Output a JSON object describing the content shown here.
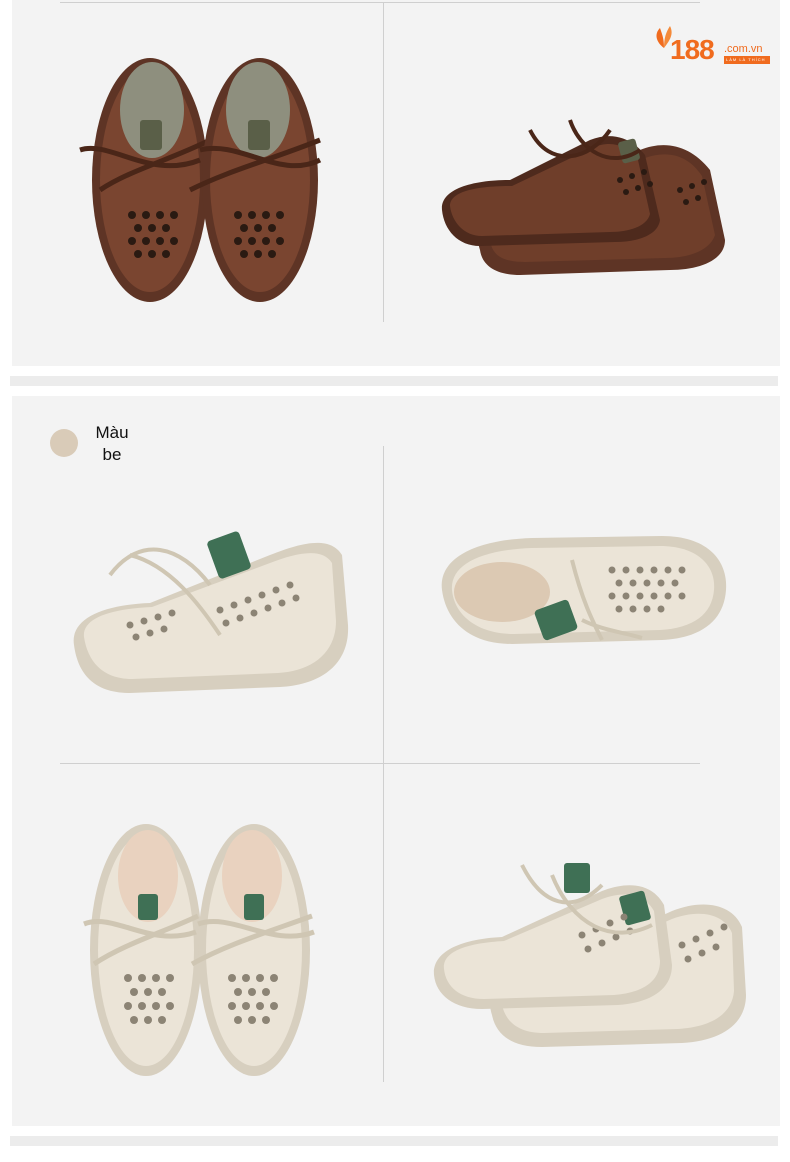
{
  "logo": {
    "number": "188",
    "domain": ".com.vn",
    "tagline": "LÀM LÀ THÍCH",
    "brand_color": "#f06b1e"
  },
  "color_variant": {
    "label": "Màu be",
    "swatch_color": "#d9cbb8"
  },
  "products": [
    {
      "name": "brown-shoes-top-view",
      "color": "#7a4530"
    },
    {
      "name": "brown-shoes-side-view",
      "color": "#6f3e2a"
    },
    {
      "name": "beige-shoe-side-view",
      "color": "#e6ded0"
    },
    {
      "name": "beige-shoe-laid-view",
      "color": "#e6ded0"
    },
    {
      "name": "beige-shoes-top-view",
      "color": "#e6ded0"
    },
    {
      "name": "beige-shoes-side-view",
      "color": "#e6ded0"
    }
  ]
}
